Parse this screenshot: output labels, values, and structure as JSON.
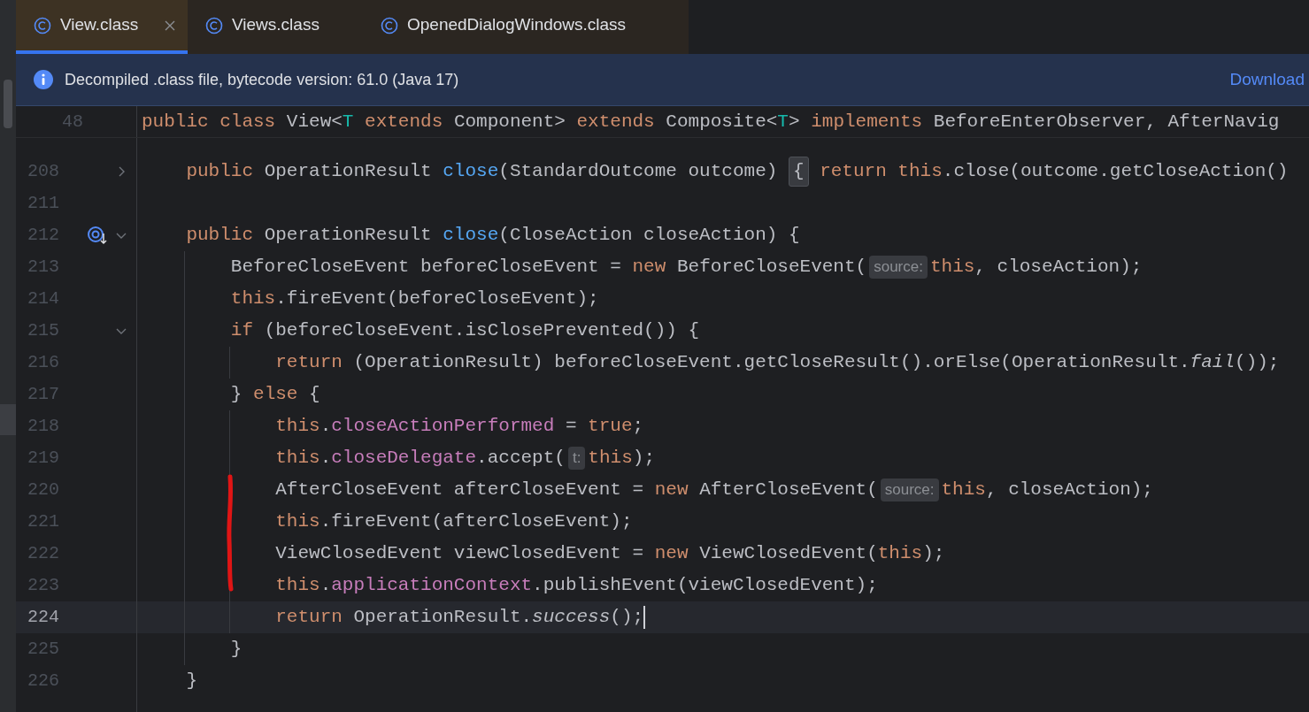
{
  "tabs": [
    {
      "label": "View.class",
      "selected": true,
      "closable": true
    },
    {
      "label": "Views.class",
      "selected": false
    },
    {
      "label": "OpenedDialogWindows.class",
      "selected": false
    }
  ],
  "banner": {
    "message": "Decompiled .class file, bytecode version: 61.0 (Java 17)",
    "link": "Download"
  },
  "sticky_line": {
    "number": "48",
    "tokens": [
      {
        "kind": "keyword",
        "text": "public class "
      },
      {
        "kind": "plain",
        "text": "View<"
      },
      {
        "kind": "type_param",
        "text": "T"
      },
      {
        "kind": "keyword",
        "text": " extends "
      },
      {
        "kind": "plain",
        "text": "Component> "
      },
      {
        "kind": "keyword",
        "text": "extends "
      },
      {
        "kind": "plain",
        "text": "Composite<"
      },
      {
        "kind": "type_param",
        "text": "T"
      },
      {
        "kind": "plain",
        "text": "> "
      },
      {
        "kind": "keyword",
        "text": "implements "
      },
      {
        "kind": "plain",
        "text": "BeforeEnterObserver, AfterNavig"
      }
    ]
  },
  "lines": [
    {
      "number": "208",
      "expanded": false,
      "tokens": [
        {
          "kind": "keyword",
          "text": "    public "
        },
        {
          "kind": "plain",
          "text": "OperationResult "
        },
        {
          "kind": "method",
          "text": "close"
        },
        {
          "kind": "plain",
          "text": "(StandardOutcome outcome) "
        },
        {
          "kind": "folded",
          "text": "{"
        },
        {
          "kind": "keyword",
          "text": " return this"
        },
        {
          "kind": "plain",
          "text": ".close(outcome.getCloseAction()"
        }
      ]
    },
    {
      "number": "211"
    },
    {
      "number": "212",
      "expanded": true,
      "override_marker": true,
      "tokens": [
        {
          "kind": "keyword",
          "text": "    public "
        },
        {
          "kind": "plain",
          "text": "OperationResult "
        },
        {
          "kind": "method",
          "text": "close"
        },
        {
          "kind": "plain",
          "text": "(CloseAction closeAction) {"
        }
      ]
    },
    {
      "number": "213",
      "tokens": [
        {
          "kind": "plain",
          "text": "        BeforeCloseEvent beforeCloseEvent = "
        },
        {
          "kind": "keyword",
          "text": "new "
        },
        {
          "kind": "plain",
          "text": "BeforeCloseEvent("
        },
        {
          "kind": "hint",
          "text": "source:"
        },
        {
          "kind": "keyword",
          "text": "this"
        },
        {
          "kind": "plain",
          "text": ", closeAction);"
        }
      ]
    },
    {
      "number": "214",
      "tokens": [
        {
          "kind": "keyword",
          "text": "        this"
        },
        {
          "kind": "plain",
          "text": ".fireEvent(beforeCloseEvent);"
        }
      ]
    },
    {
      "number": "215",
      "expanded": true,
      "tokens": [
        {
          "kind": "keyword",
          "text": "        if "
        },
        {
          "kind": "plain",
          "text": "(beforeCloseEvent.isClosePrevented()) {"
        }
      ]
    },
    {
      "number": "216",
      "tokens": [
        {
          "kind": "keyword",
          "text": "            return "
        },
        {
          "kind": "plain",
          "text": "(OperationResult) beforeCloseEvent.getCloseResult().orElse(OperationResult."
        },
        {
          "kind": "static",
          "text": "fail"
        },
        {
          "kind": "plain",
          "text": "());"
        }
      ]
    },
    {
      "number": "217",
      "tokens": [
        {
          "kind": "plain",
          "text": "        } "
        },
        {
          "kind": "keyword",
          "text": "else "
        },
        {
          "kind": "plain",
          "text": "{"
        }
      ]
    },
    {
      "number": "218",
      "tokens": [
        {
          "kind": "keyword",
          "text": "            this"
        },
        {
          "kind": "plain",
          "text": "."
        },
        {
          "kind": "field",
          "text": "closeActionPerformed"
        },
        {
          "kind": "plain",
          "text": " = "
        },
        {
          "kind": "keyword",
          "text": "true"
        },
        {
          "kind": "plain",
          "text": ";"
        }
      ]
    },
    {
      "number": "219",
      "tokens": [
        {
          "kind": "keyword",
          "text": "            this"
        },
        {
          "kind": "plain",
          "text": "."
        },
        {
          "kind": "field",
          "text": "closeDelegate"
        },
        {
          "kind": "plain",
          "text": ".accept("
        },
        {
          "kind": "hint",
          "text": "t:"
        },
        {
          "kind": "keyword",
          "text": "this"
        },
        {
          "kind": "plain",
          "text": ");"
        }
      ]
    },
    {
      "number": "220",
      "tokens": [
        {
          "kind": "plain",
          "text": "            AfterCloseEvent afterCloseEvent = "
        },
        {
          "kind": "keyword",
          "text": "new "
        },
        {
          "kind": "plain",
          "text": "AfterCloseEvent("
        },
        {
          "kind": "hint",
          "text": "source:"
        },
        {
          "kind": "keyword",
          "text": "this"
        },
        {
          "kind": "plain",
          "text": ", closeAction);"
        }
      ]
    },
    {
      "number": "221",
      "tokens": [
        {
          "kind": "keyword",
          "text": "            this"
        },
        {
          "kind": "plain",
          "text": ".fireEvent(afterCloseEvent);"
        }
      ]
    },
    {
      "number": "222",
      "tokens": [
        {
          "kind": "plain",
          "text": "            ViewClosedEvent viewClosedEvent = "
        },
        {
          "kind": "keyword",
          "text": "new "
        },
        {
          "kind": "plain",
          "text": "ViewClosedEvent("
        },
        {
          "kind": "keyword",
          "text": "this"
        },
        {
          "kind": "plain",
          "text": ");"
        }
      ]
    },
    {
      "number": "223",
      "tokens": [
        {
          "kind": "keyword",
          "text": "            this"
        },
        {
          "kind": "plain",
          "text": "."
        },
        {
          "kind": "field",
          "text": "applicationContext"
        },
        {
          "kind": "plain",
          "text": ".publishEvent(viewClosedEvent);"
        }
      ]
    },
    {
      "number": "224",
      "current": true,
      "tokens": [
        {
          "kind": "keyword",
          "text": "            return "
        },
        {
          "kind": "plain",
          "text": "OperationResult."
        },
        {
          "kind": "static",
          "text": "success"
        },
        {
          "kind": "plain",
          "text": "();"
        }
      ]
    },
    {
      "number": "225",
      "tokens": [
        {
          "kind": "plain",
          "text": "        }"
        }
      ]
    },
    {
      "number": "226",
      "tokens": [
        {
          "kind": "plain",
          "text": "    }"
        }
      ]
    }
  ]
}
